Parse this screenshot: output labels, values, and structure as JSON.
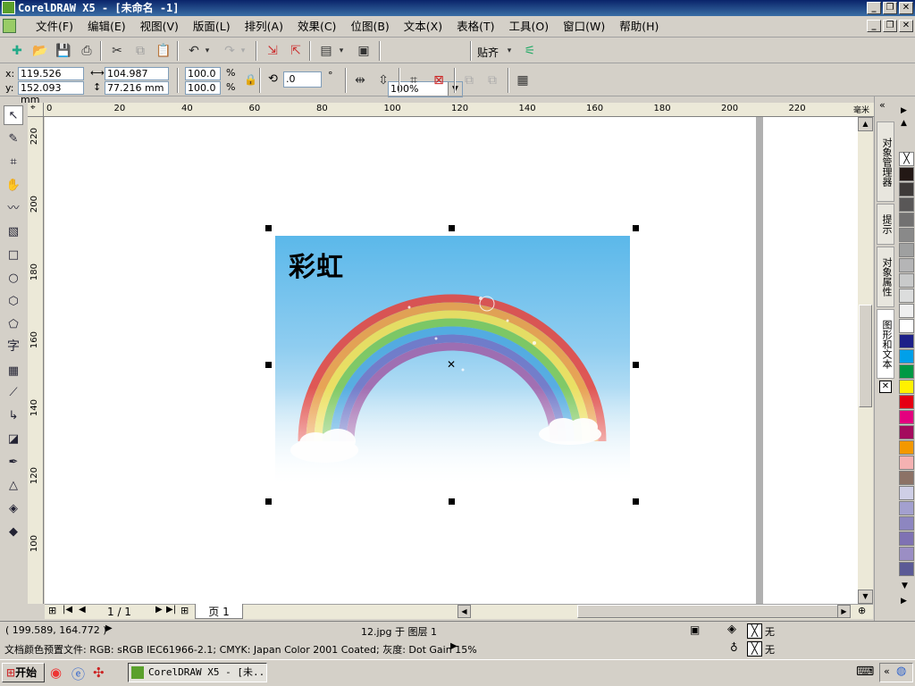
{
  "window": {
    "title": "CorelDRAW X5 - [未命名 -1]"
  },
  "menu": [
    "文件(F)",
    "编辑(E)",
    "视图(V)",
    "版面(L)",
    "排列(A)",
    "效果(C)",
    "位图(B)",
    "文本(X)",
    "表格(T)",
    "工具(O)",
    "窗口(W)",
    "帮助(H)"
  ],
  "toolbar": {
    "zoom": "100%",
    "snap": "贴齐"
  },
  "props": {
    "x_label": "x:",
    "x": "119.526 mm",
    "y_label": "y:",
    "y": "152.093 mm",
    "w": "104.987 mm",
    "h": "77.216 mm",
    "scale_w": "100.0",
    "scale_h": "100.0",
    "pct": "%",
    "rotate": ".0",
    "deg": "°"
  },
  "ruler": {
    "h_ticks": [
      "0",
      "20",
      "40",
      "60",
      "80",
      "100",
      "120",
      "140",
      "160",
      "180",
      "200",
      "220"
    ],
    "h_unit": "毫米",
    "v_ticks": [
      "220",
      "200",
      "180",
      "160",
      "140",
      "120",
      "100"
    ]
  },
  "image": {
    "caption": "彩虹"
  },
  "docker_tabs": [
    "对象管理器",
    "提示",
    "对象属性",
    "图形和文本"
  ],
  "palette": [
    "#ffffff",
    "#231815",
    "#3e3a39",
    "#595757",
    "#727171",
    "#898989",
    "#9fa0a0",
    "#b5b5b6",
    "#c9caca",
    "#dcdddd",
    "#efefef",
    "#ffffff",
    "#1d2088",
    "#00a0e9",
    "#009944",
    "#fff100",
    "#e60012",
    "#e4007f",
    "#a40b5d",
    "#f39800",
    "#f5b2b2",
    "#8c7266",
    "#cfcfe6",
    "#a3a0cf",
    "#8d86c0",
    "#7f72b3",
    "#9b8ec4",
    "#5b5a96"
  ],
  "pager": {
    "count": "1 / 1",
    "tab": "页 1"
  },
  "status": {
    "coords": "( 199.589, 164.772 )",
    "object": "12.jpg 于 图层 1",
    "fill": "无",
    "outline": "无",
    "profile": "文档颜色预置文件: RGB: sRGB IEC61966-2.1; CMYK: Japan Color 2001 Coated; 灰度: Dot Gain 15%"
  },
  "taskbar": {
    "start": "开始",
    "task": "CorelDRAW X5 - [未..."
  }
}
